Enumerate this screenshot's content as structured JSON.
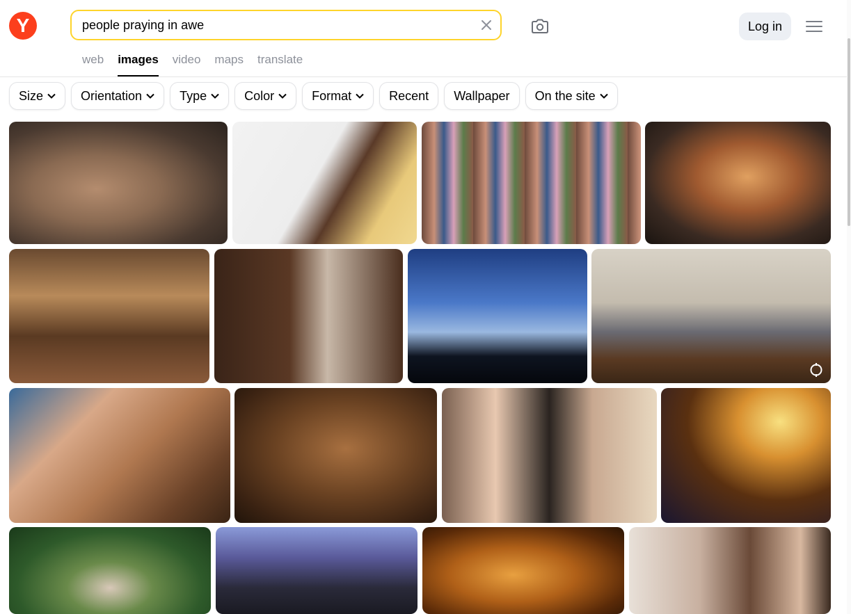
{
  "header": {
    "logo_letter": "Y",
    "search_value": "people praying in awe",
    "login_label": "Log in",
    "icons": {
      "clear": "close-icon",
      "camera": "camera-icon",
      "menu": "menu-icon"
    }
  },
  "tabs": [
    {
      "label": "web"
    },
    {
      "label": "images",
      "active": true
    },
    {
      "label": "video"
    },
    {
      "label": "maps"
    },
    {
      "label": "translate"
    }
  ],
  "filters": [
    {
      "label": "Size",
      "dropdown": true
    },
    {
      "label": "Orientation",
      "dropdown": true
    },
    {
      "label": "Type",
      "dropdown": true
    },
    {
      "label": "Color",
      "dropdown": true
    },
    {
      "label": "Format",
      "dropdown": true
    },
    {
      "label": "Recent",
      "dropdown": false
    },
    {
      "label": "Wallpaper",
      "dropdown": false
    },
    {
      "label": "On the site",
      "dropdown": true
    }
  ],
  "colors": {
    "brand": "#fc3f1d",
    "search_border": "#fed42b",
    "tab_inactive": "#8d919a",
    "button_bg": "#eceff4"
  }
}
